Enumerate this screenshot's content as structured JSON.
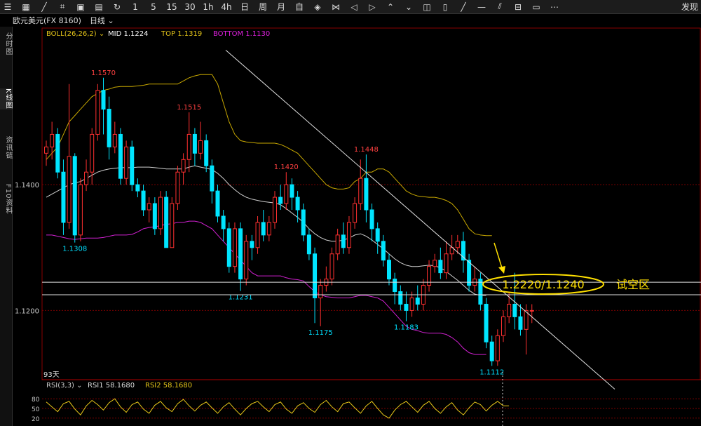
{
  "toolbar": {
    "items": [
      "☰",
      "▦",
      "╱",
      "⌗",
      "▣",
      "▤",
      "↻",
      "1",
      "5",
      "15",
      "30",
      "1h",
      "4h",
      "日",
      "周",
      "月",
      "自",
      "◈",
      "⋈",
      "◁",
      "▷",
      "⌃",
      "⌄",
      "◫",
      "▯",
      "╱",
      "—",
      "⫽",
      "⊟",
      "▭",
      "⋯"
    ],
    "right_label": "发现"
  },
  "title": {
    "symbol": "欧元美元(FX 8160)",
    "period": "日线"
  },
  "sidebar": {
    "tabs": [
      "分时图",
      "K线图",
      "资讯链",
      "F10资料"
    ]
  },
  "indicator": {
    "boll_label": "BOLL(26,26,2)",
    "mid": "MID 1.1224",
    "top": "TOP 1.1319",
    "bottom": "BOTTOM 1.1130",
    "colors": {
      "boll_name": "#e6c619",
      "mid": "#ffffff",
      "top": "#e6c619",
      "bottom": "#e020e0"
    }
  },
  "days_label": "93天",
  "zone": {
    "label": "试空区",
    "price_text": "1.2220/1.1240"
  },
  "rsi": {
    "label": "RSI(3,3)",
    "rsi1": "RSI1 58.1680",
    "rsi2": "RSI2 58.1680"
  },
  "colors": {
    "up": "#ff3030",
    "down": "#00e5ff",
    "top_band": "#c8a800",
    "mid_band": "#d0d0d0",
    "bottom_band": "#d020d0",
    "high_label": "#ff4040",
    "low_label": "#00e0ff",
    "zone": "#ffe000",
    "rsi_line": "#e6c619",
    "grid": "#7a0000"
  },
  "chart_data": {
    "type": "candlestick",
    "y_axis_ticks": [
      1.14,
      1.12
    ],
    "y_axis_tick_labels": [
      "1.1400",
      "1.1200"
    ],
    "ylim": [
      1.109,
      1.163
    ],
    "candles": [
      [
        1.145,
        1.146,
        1.143,
        1.147
      ],
      [
        1.146,
        1.148,
        1.144,
        1.15
      ],
      [
        1.148,
        1.142,
        1.141,
        1.149
      ],
      [
        1.142,
        1.134,
        1.132,
        1.144
      ],
      [
        1.134,
        1.1445,
        1.133,
        1.156
      ],
      [
        1.1445,
        1.132,
        1.1308,
        1.145
      ],
      [
        1.132,
        1.14,
        1.131,
        1.141
      ],
      [
        1.14,
        1.142,
        1.139,
        1.144
      ],
      [
        1.142,
        1.148,
        1.14,
        1.149
      ],
      [
        1.148,
        1.155,
        1.147,
        1.156
      ],
      [
        1.155,
        1.152,
        1.148,
        1.157
      ],
      [
        1.152,
        1.146,
        1.144,
        1.154
      ],
      [
        1.146,
        1.148,
        1.145,
        1.15
      ],
      [
        1.148,
        1.141,
        1.14,
        1.149
      ],
      [
        1.141,
        1.146,
        1.14,
        1.147
      ],
      [
        1.146,
        1.14,
        1.139,
        1.147
      ],
      [
        1.14,
        1.139,
        1.138,
        1.141
      ],
      [
        1.139,
        1.136,
        1.135,
        1.14
      ],
      [
        1.136,
        1.137,
        1.134,
        1.138
      ],
      [
        1.137,
        1.133,
        1.132,
        1.138
      ],
      [
        1.133,
        1.138,
        1.132,
        1.139
      ],
      [
        1.138,
        1.13,
        1.13,
        1.139
      ],
      [
        1.13,
        1.137,
        1.13,
        1.138
      ],
      [
        1.137,
        1.142,
        1.136,
        1.143
      ],
      [
        1.142,
        1.144,
        1.14,
        1.145
      ],
      [
        1.144,
        1.148,
        1.142,
        1.1515
      ],
      [
        1.148,
        1.145,
        1.143,
        1.149
      ],
      [
        1.145,
        1.147,
        1.144,
        1.15
      ],
      [
        1.147,
        1.143,
        1.142,
        1.148
      ],
      [
        1.143,
        1.139,
        1.137,
        1.144
      ],
      [
        1.139,
        1.135,
        1.134,
        1.14
      ],
      [
        1.135,
        1.133,
        1.131,
        1.136
      ],
      [
        1.133,
        1.127,
        1.126,
        1.134
      ],
      [
        1.127,
        1.133,
        1.126,
        1.134
      ],
      [
        1.133,
        1.125,
        1.1231,
        1.134
      ],
      [
        1.125,
        1.131,
        1.124,
        1.132
      ],
      [
        1.131,
        1.13,
        1.128,
        1.132
      ],
      [
        1.13,
        1.134,
        1.129,
        1.135
      ],
      [
        1.134,
        1.132,
        1.131,
        1.136
      ],
      [
        1.132,
        1.134,
        1.131,
        1.135
      ],
      [
        1.134,
        1.138,
        1.133,
        1.139
      ],
      [
        1.138,
        1.137,
        1.136,
        1.14
      ],
      [
        1.137,
        1.14,
        1.136,
        1.142
      ],
      [
        1.14,
        1.138,
        1.136,
        1.141
      ],
      [
        1.138,
        1.136,
        1.134,
        1.139
      ],
      [
        1.136,
        1.132,
        1.131,
        1.137
      ],
      [
        1.132,
        1.129,
        1.128,
        1.133
      ],
      [
        1.129,
        1.122,
        1.118,
        1.13
      ],
      [
        1.122,
        1.124,
        1.1175,
        1.125
      ],
      [
        1.124,
        1.125,
        1.123,
        1.127
      ],
      [
        1.125,
        1.129,
        1.124,
        1.13
      ],
      [
        1.129,
        1.132,
        1.128,
        1.133
      ],
      [
        1.132,
        1.13,
        1.129,
        1.134
      ],
      [
        1.13,
        1.134,
        1.129,
        1.135
      ],
      [
        1.134,
        1.137,
        1.133,
        1.138
      ],
      [
        1.137,
        1.141,
        1.136,
        1.144
      ],
      [
        1.141,
        1.136,
        1.134,
        1.1448
      ],
      [
        1.136,
        1.133,
        1.131,
        1.137
      ],
      [
        1.133,
        1.131,
        1.129,
        1.134
      ],
      [
        1.131,
        1.128,
        1.127,
        1.132
      ],
      [
        1.128,
        1.125,
        1.124,
        1.129
      ],
      [
        1.125,
        1.123,
        1.121,
        1.126
      ],
      [
        1.123,
        1.121,
        1.12,
        1.124
      ],
      [
        1.121,
        1.12,
        1.1183,
        1.123
      ],
      [
        1.12,
        1.122,
        1.119,
        1.123
      ],
      [
        1.122,
        1.121,
        1.12,
        1.124
      ],
      [
        1.121,
        1.124,
        1.12,
        1.125
      ],
      [
        1.124,
        1.127,
        1.123,
        1.128
      ],
      [
        1.127,
        1.128,
        1.126,
        1.129
      ],
      [
        1.128,
        1.126,
        1.125,
        1.13
      ],
      [
        1.126,
        1.129,
        1.125,
        1.131
      ],
      [
        1.129,
        1.13,
        1.128,
        1.132
      ],
      [
        1.13,
        1.131,
        1.129,
        1.132
      ],
      [
        1.131,
        1.128,
        1.126,
        1.1325
      ],
      [
        1.128,
        1.124,
        1.123,
        1.129
      ],
      [
        1.124,
        1.125,
        1.123,
        1.127
      ],
      [
        1.125,
        1.121,
        1.12,
        1.126
      ],
      [
        1.121,
        1.115,
        1.114,
        1.122
      ],
      [
        1.115,
        1.112,
        1.1112,
        1.116
      ],
      [
        1.112,
        1.116,
        1.1112,
        1.117
      ],
      [
        1.116,
        1.119,
        1.115,
        1.12
      ],
      [
        1.119,
        1.121,
        1.118,
        1.123
      ],
      [
        1.121,
        1.119,
        1.117,
        1.126
      ],
      [
        1.119,
        1.117,
        1.116,
        1.121
      ],
      [
        1.117,
        1.12,
        1.113,
        1.121
      ],
      [
        1.12,
        1.12,
        1.118,
        1.121
      ]
    ],
    "high_low_labels": [
      {
        "i": 10,
        "price": 1.157,
        "text": "1.1570",
        "kind": "high"
      },
      {
        "i": 25,
        "price": 1.1515,
        "text": "1.1515",
        "kind": "high"
      },
      {
        "i": 42,
        "price": 1.142,
        "text": "1.1420",
        "kind": "high"
      },
      {
        "i": 56,
        "price": 1.1448,
        "text": "1.1448",
        "kind": "high"
      },
      {
        "i": 5,
        "price": 1.1308,
        "text": "1.1308",
        "kind": "low"
      },
      {
        "i": 34,
        "price": 1.1231,
        "text": "1.1231",
        "kind": "low"
      },
      {
        "i": 48,
        "price": 1.1175,
        "text": "1.1175",
        "kind": "low"
      },
      {
        "i": 63,
        "price": 1.1183,
        "text": "1.1183",
        "kind": "low"
      },
      {
        "i": 78,
        "price": 1.1112,
        "text": "1.1112",
        "kind": "low"
      }
    ],
    "boll_top": [
      1.144,
      1.145,
      1.146,
      1.148,
      1.15,
      1.151,
      1.152,
      1.153,
      1.154,
      1.1545,
      1.155,
      1.1552,
      1.1555,
      1.1556,
      1.1556,
      1.1556,
      1.1557,
      1.1558,
      1.156,
      1.156,
      1.156,
      1.156,
      1.156,
      1.156,
      1.1565,
      1.157,
      1.1573,
      1.1575,
      1.1575,
      1.1575,
      1.156,
      1.153,
      1.15,
      1.148,
      1.147,
      1.1468,
      1.1467,
      1.1466,
      1.1466,
      1.1466,
      1.1466,
      1.1464,
      1.146,
      1.1455,
      1.145,
      1.144,
      1.143,
      1.142,
      1.141,
      1.14,
      1.1395,
      1.1393,
      1.1393,
      1.1395,
      1.1405,
      1.141,
      1.142,
      1.142,
      1.1425,
      1.1425,
      1.142,
      1.141,
      1.14,
      1.139,
      1.1385,
      1.1382,
      1.1381,
      1.138,
      1.138,
      1.1378,
      1.1375,
      1.137,
      1.136,
      1.1345,
      1.133,
      1.1322,
      1.132,
      1.1319,
      1.1319
    ],
    "boll_mid": [
      1.138,
      1.1385,
      1.139,
      1.1395,
      1.14,
      1.1403,
      1.1405,
      1.141,
      1.1415,
      1.142,
      1.1423,
      1.1425,
      1.1426,
      1.1427,
      1.1427,
      1.1427,
      1.1428,
      1.1428,
      1.1428,
      1.1427,
      1.1426,
      1.1425,
      1.1425,
      1.1425,
      1.1425,
      1.1428,
      1.143,
      1.1428,
      1.1426,
      1.1424,
      1.1418,
      1.141,
      1.14,
      1.1392,
      1.1385,
      1.138,
      1.1377,
      1.1375,
      1.1373,
      1.1372,
      1.1371,
      1.1368,
      1.1362,
      1.1355,
      1.1348,
      1.134,
      1.133,
      1.1322,
      1.1316,
      1.1312,
      1.131,
      1.131,
      1.1312,
      1.1315,
      1.132,
      1.1322,
      1.1318,
      1.1312,
      1.1305,
      1.1298,
      1.129,
      1.1282,
      1.1276,
      1.1272,
      1.127,
      1.127,
      1.1271,
      1.1272,
      1.1271,
      1.1268,
      1.1262,
      1.1255,
      1.1248,
      1.124,
      1.1232,
      1.1226,
      1.1224,
      1.1224
    ],
    "boll_bottom": [
      1.132,
      1.132,
      1.1318,
      1.1316,
      1.1314,
      1.1313,
      1.1314,
      1.1315,
      1.1315,
      1.1315,
      1.1316,
      1.1318,
      1.132,
      1.132,
      1.132,
      1.1321,
      1.1325,
      1.133,
      1.1332,
      1.1333,
      1.1335,
      1.1337,
      1.1338,
      1.134,
      1.134,
      1.1342,
      1.1342,
      1.134,
      1.1335,
      1.133,
      1.132,
      1.131,
      1.13,
      1.129,
      1.128,
      1.127,
      1.126,
      1.1255,
      1.1255,
      1.1255,
      1.1255,
      1.1255,
      1.1252,
      1.125,
      1.1249,
      1.1247,
      1.1238,
      1.123,
      1.1225,
      1.1222,
      1.1221,
      1.122,
      1.122,
      1.122,
      1.1222,
      1.1224,
      1.1224,
      1.1222,
      1.122,
      1.1215,
      1.1205,
      1.1195,
      1.1185,
      1.1175,
      1.117,
      1.1168,
      1.1165,
      1.1164,
      1.1164,
      1.1164,
      1.1162,
      1.1157,
      1.115,
      1.114,
      1.1133,
      1.113,
      1.113,
      1.113
    ],
    "trend_line": [
      [
        1.1614,
        0
      ],
      [
        1.1075,
        0
      ]
    ],
    "zone_lines": [
      1.1245,
      1.1225
    ],
    "rsi1": [
      70,
      55,
      40,
      65,
      72,
      48,
      30,
      58,
      75,
      62,
      45,
      68,
      80,
      55,
      38,
      62,
      70,
      48,
      35,
      60,
      72,
      52,
      40,
      65,
      78,
      58,
      42,
      60,
      70,
      52,
      35,
      55,
      68,
      48,
      30,
      50,
      65,
      72,
      55,
      40,
      62,
      70,
      48,
      35,
      58,
      68,
      50,
      38,
      62,
      75,
      55,
      40,
      65,
      70,
      52,
      35,
      58,
      72,
      50,
      30,
      20,
      45,
      62,
      72,
      55,
      38,
      60,
      72,
      50,
      35,
      55,
      68,
      45,
      30,
      52,
      70,
      62,
      42,
      60,
      72,
      58,
      58
    ],
    "rsi_ticks": [
      80,
      50,
      20
    ],
    "rsi_tick_labels": [
      "80",
      "50",
      "20"
    ]
  }
}
